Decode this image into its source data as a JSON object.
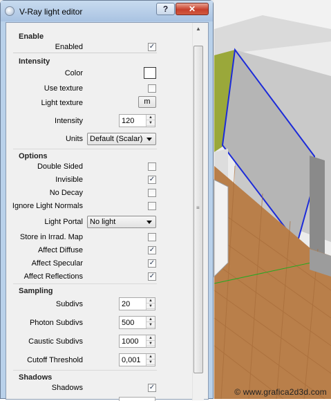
{
  "window": {
    "title": "V-Ray light editor",
    "help_label": "?",
    "close_label": "✕"
  },
  "watermark": "© www.grafica2d3d.com",
  "enable": {
    "header": "Enable",
    "enabled_label": "Enabled",
    "enabled": true
  },
  "intensity": {
    "header": "Intensity",
    "color_label": "Color",
    "color": "#ffffff",
    "use_texture_label": "Use texture",
    "use_texture": false,
    "light_texture_label": "Light texture",
    "light_texture_button": "m",
    "intensity_label": "Intensity",
    "intensity_value": "120",
    "units_label": "Units",
    "units_value": "Default (Scalar)"
  },
  "options": {
    "header": "Options",
    "double_sided_label": "Double Sided",
    "double_sided": false,
    "invisible_label": "Invisible",
    "invisible": true,
    "no_decay_label": "No Decay",
    "no_decay": false,
    "ignore_normals_label": "Ignore Light Normals",
    "ignore_normals": false,
    "light_portal_label": "Light Portal",
    "light_portal_value": "No light",
    "store_irrad_label": "Store in Irrad. Map",
    "store_irrad": false,
    "affect_diffuse_label": "Affect Diffuse",
    "affect_diffuse": true,
    "affect_specular_label": "Affect Specular",
    "affect_specular": true,
    "affect_reflections_label": "Affect Reflections",
    "affect_reflections": true
  },
  "sampling": {
    "header": "Sampling",
    "subdivs_label": "Subdivs",
    "subdivs_value": "20",
    "photon_label": "Photon Subdivs",
    "photon_value": "500",
    "caustic_label": "Caustic Subdivs",
    "caustic_value": "1000",
    "cutoff_label": "Cutoff Threshold",
    "cutoff_value": "0,001"
  },
  "shadows": {
    "header": "Shadows",
    "shadows_label": "Shadows",
    "shadows": true
  }
}
